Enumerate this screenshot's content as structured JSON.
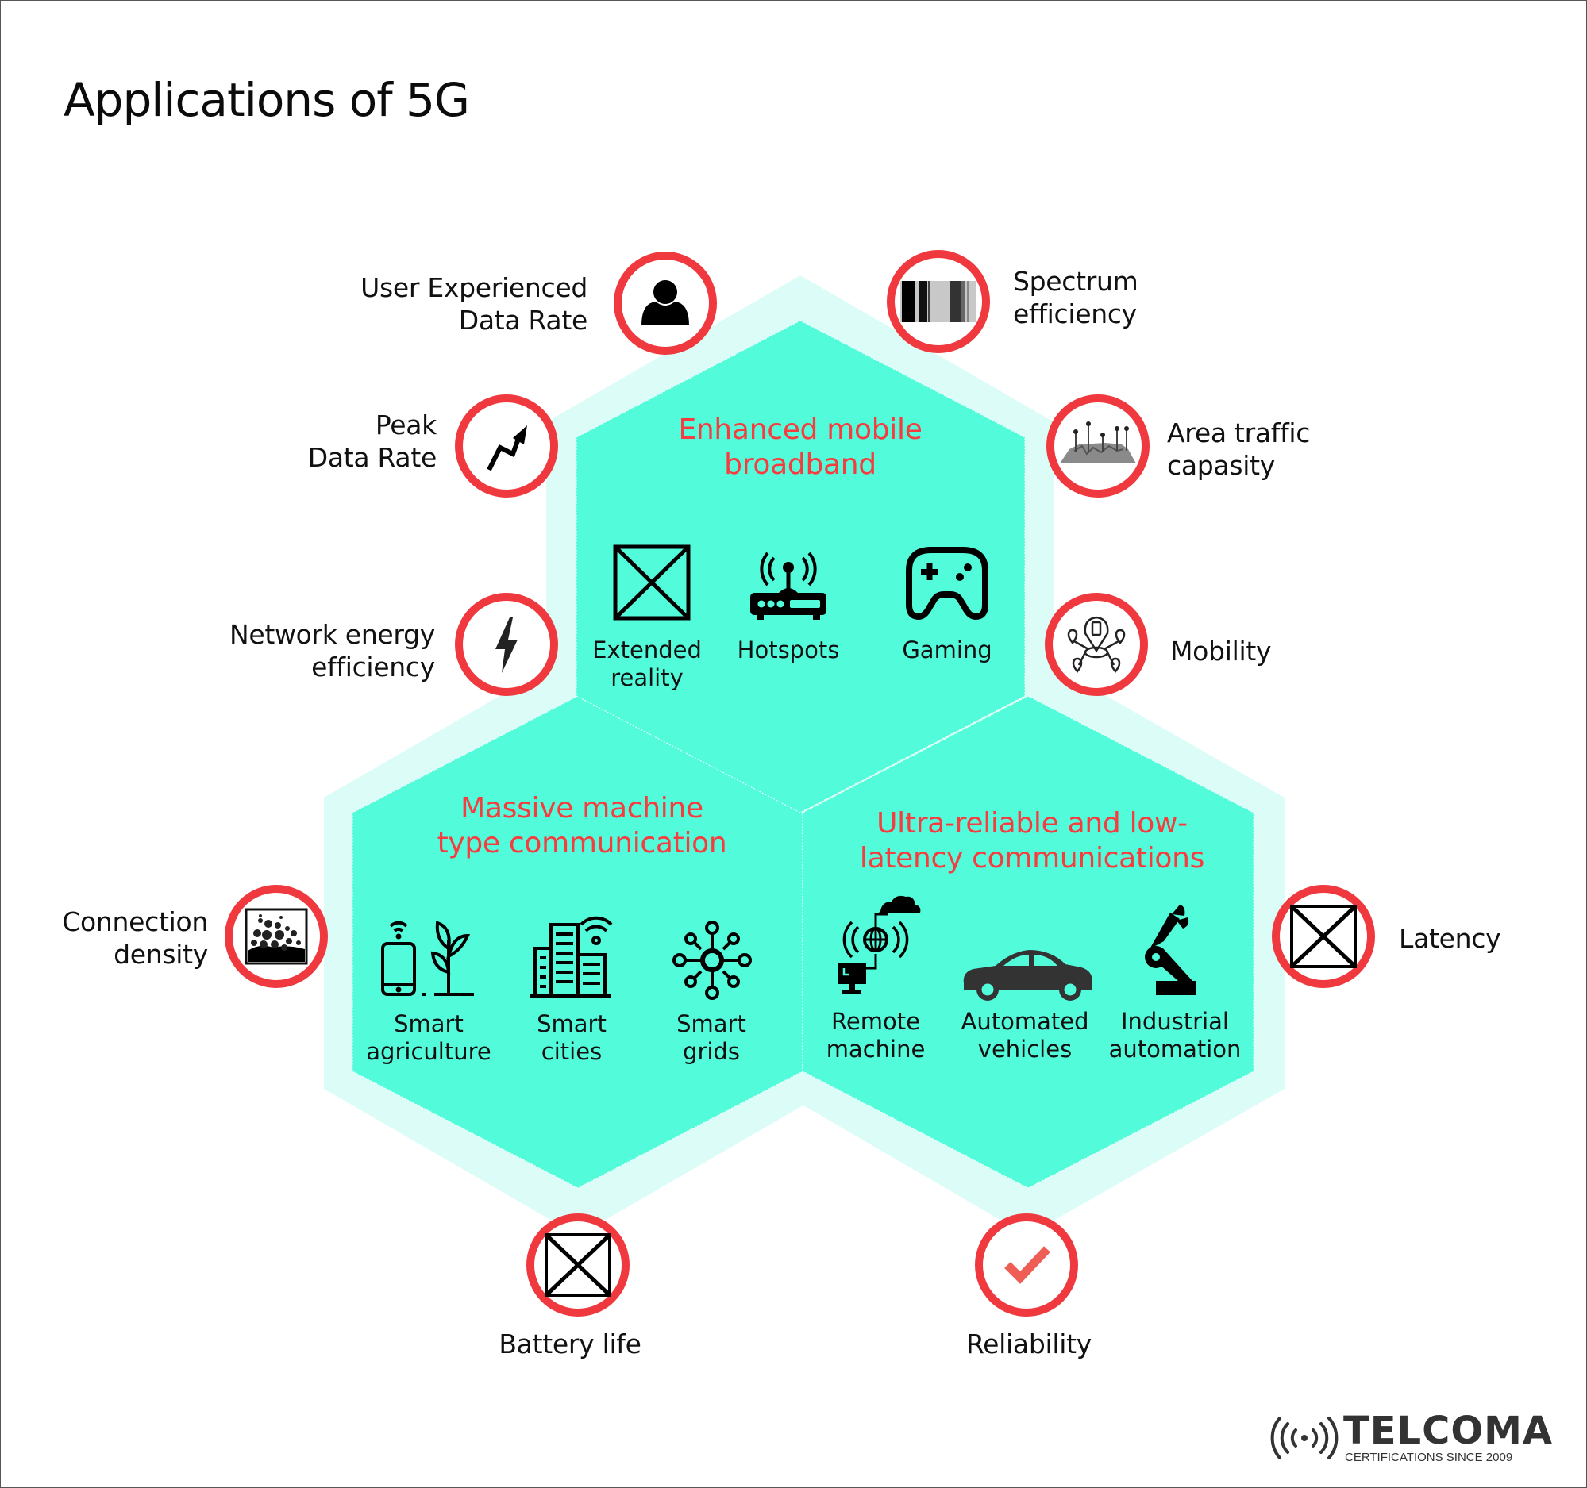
{
  "title": "Applications of 5G",
  "colors": {
    "teal": "#52FCDB",
    "teal_glow": "#DCFCF8",
    "ring_red": "#F0393E",
    "heading_red": "#F63C3E",
    "check_red": "#EE5E55"
  },
  "categories": [
    {
      "id": "embb",
      "heading": [
        "Enhanced mobile",
        "broadband"
      ],
      "applications": [
        {
          "label": [
            "Extended",
            "reality"
          ],
          "icon": "broken-image-icon"
        },
        {
          "label": [
            "Hotspots"
          ],
          "icon": "router-hotspot-icon"
        },
        {
          "label": [
            "Gaming"
          ],
          "icon": "gamepad-icon"
        }
      ]
    },
    {
      "id": "mmtc",
      "heading": [
        "Massive machine",
        "type communication"
      ],
      "applications": [
        {
          "label": [
            "Smart",
            "agriculture"
          ],
          "icon": "smart-agriculture-icon"
        },
        {
          "label": [
            "Smart",
            "cities"
          ],
          "icon": "smart-city-icon"
        },
        {
          "label": [
            "Smart",
            "grids"
          ],
          "icon": "smart-grid-icon"
        }
      ]
    },
    {
      "id": "urllc",
      "heading": [
        "Ultra-reliable and low-",
        "latency communications"
      ],
      "applications": [
        {
          "label": [
            "Remote",
            "machine"
          ],
          "icon": "remote-machine-icon"
        },
        {
          "label": [
            "Automated",
            "vehicles"
          ],
          "icon": "car-icon"
        },
        {
          "label": [
            "Industrial",
            "automation"
          ],
          "icon": "robot-arm-icon"
        }
      ]
    }
  ],
  "kpis": [
    {
      "id": "user-experienced-data-rate",
      "label": [
        "User Experienced",
        "Data Rate"
      ],
      "icon": "user-icon"
    },
    {
      "id": "spectrum-efficiency",
      "label": [
        "Spectrum",
        "efficiency"
      ],
      "icon": "spectrum-bars-icon"
    },
    {
      "id": "peak-data-rate",
      "label": [
        "Peak",
        "Data Rate"
      ],
      "icon": "zigzag-arrow-up-icon"
    },
    {
      "id": "area-traffic-capacity",
      "label": [
        "Area traffic",
        "capasity"
      ],
      "icon": "antenna-terrain-icon"
    },
    {
      "id": "network-energy-efficiency",
      "label": [
        "Network energy",
        "efficiency"
      ],
      "icon": "lightning-bolt-icon"
    },
    {
      "id": "mobility",
      "label": [
        "Mobility"
      ],
      "icon": "mobility-network-icon"
    },
    {
      "id": "connection-density",
      "label": [
        "Connection",
        "density"
      ],
      "icon": "dense-particles-icon"
    },
    {
      "id": "latency",
      "label": [
        "Latency"
      ],
      "icon": "broken-image-icon"
    },
    {
      "id": "battery-life",
      "label": [
        "Battery life"
      ],
      "icon": "broken-image-icon"
    },
    {
      "id": "reliability",
      "label": [
        "Reliability"
      ],
      "icon": "checkmark-icon"
    }
  ],
  "logo": {
    "name": "TELCOMA",
    "tagline": "CERTIFICATIONS SINCE 2009",
    "icon": "signal-waves-icon"
  }
}
